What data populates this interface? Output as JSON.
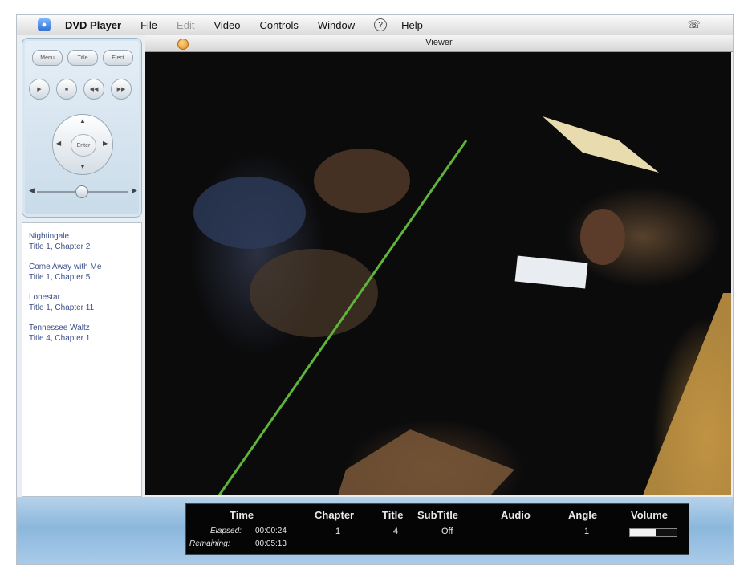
{
  "menubar": {
    "app_name": "DVD Player",
    "items": [
      "File",
      "Edit",
      "Video",
      "Controls",
      "Window",
      "Help"
    ],
    "disabled_item": "Edit",
    "help_icon": "?",
    "right_icon": "phone-icon"
  },
  "viewer": {
    "title": "Viewer"
  },
  "remote": {
    "top_buttons": [
      "Menu",
      "Title",
      "Eject"
    ],
    "round_buttons": [
      "play",
      "stop",
      "prev",
      "next"
    ],
    "enter_label": "Enter"
  },
  "bookmarks": [
    {
      "title": "Nightingale",
      "location": "Title 1, Chapter 2"
    },
    {
      "title": "Come Away with Me",
      "location": "Title 1, Chapter 5"
    },
    {
      "title": "Lonestar",
      "location": "Title 1, Chapter 11"
    },
    {
      "title": "Tennessee Waltz",
      "location": "Title 4, Chapter 1"
    }
  ],
  "controller": {
    "headers": {
      "time": "Time",
      "chapter": "Chapter",
      "title": "Title",
      "subtitle": "SubTitle",
      "audio": "Audio",
      "angle": "Angle",
      "volume": "Volume"
    },
    "elapsed_label": "Elapsed:",
    "elapsed_value": "00:00:24",
    "remaining_label": "Remaining:",
    "remaining_value": "00:05:13",
    "chapter": "1",
    "title": "4",
    "subtitle": "Off",
    "audio": "",
    "angle": "1",
    "volume_level": 0.55
  },
  "colors": {
    "accent": "#8bb7dc",
    "controller_bg": "#050505",
    "bookmark_text": "#3c4f8a"
  }
}
